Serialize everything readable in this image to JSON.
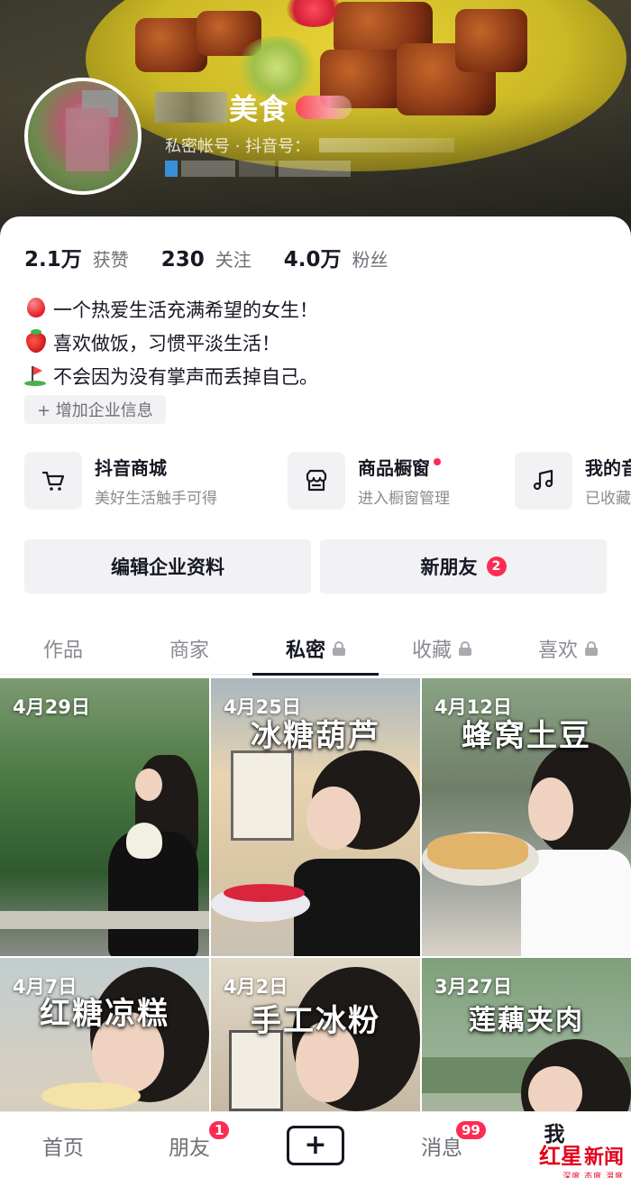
{
  "profile": {
    "name_visible": "美食",
    "account_label": "私密帐号 · 抖音号："
  },
  "stats": [
    {
      "num": "2.1万",
      "label": "获赞"
    },
    {
      "num": "230",
      "label": "关注"
    },
    {
      "num": "4.0万",
      "label": "粉丝"
    }
  ],
  "bio": [
    {
      "emoji": "balloon-icon",
      "text": "一个热爱生活充满希望的女生！"
    },
    {
      "emoji": "strawberry-icon",
      "text": "喜欢做饭，习惯平淡生活！"
    },
    {
      "emoji": "golf-flag-icon",
      "text": "不会因为没有掌声而丢掉自己。"
    }
  ],
  "biz_chip": "+ 增加企业信息",
  "services": [
    {
      "icon": "cart-icon",
      "title": "抖音商城",
      "sub": "美好生活触手可得"
    },
    {
      "icon": "shop-icon",
      "title": "商品橱窗",
      "sub": "进入橱窗管理"
    },
    {
      "icon": "music-note-icon",
      "title": "我的音",
      "sub": "已收藏"
    }
  ],
  "actions": {
    "edit": "编辑企业资料",
    "friends": "新朋友",
    "friends_badge": "2"
  },
  "tabs": [
    {
      "label": "作品",
      "locked": false
    },
    {
      "label": "商家",
      "locked": false
    },
    {
      "label": "私密",
      "locked": true
    },
    {
      "label": "收藏",
      "locked": true
    },
    {
      "label": "喜欢",
      "locked": true
    }
  ],
  "videos": [
    {
      "date": "4月29日",
      "title": ""
    },
    {
      "date": "4月25日",
      "title": "冰糖葫芦"
    },
    {
      "date": "4月12日",
      "title": "蜂窝土豆"
    },
    {
      "date": "4月7日",
      "title": "红糖凉糕"
    },
    {
      "date": "4月2日",
      "title": "手工冰粉"
    },
    {
      "date": "3月27日",
      "title": "莲藕夹肉"
    }
  ],
  "nav": {
    "home": "首页",
    "friends": "朋友",
    "friends_badge": "1",
    "plus": "+",
    "messages": "消息",
    "messages_badge": "99",
    "me": "我"
  },
  "watermark": {
    "a": "红星",
    "b": "新闻",
    "sub": "深度 态度 温度"
  },
  "colors": {
    "accent": "#fe2c55",
    "text": "#161823",
    "muted": "#8a8b91"
  }
}
